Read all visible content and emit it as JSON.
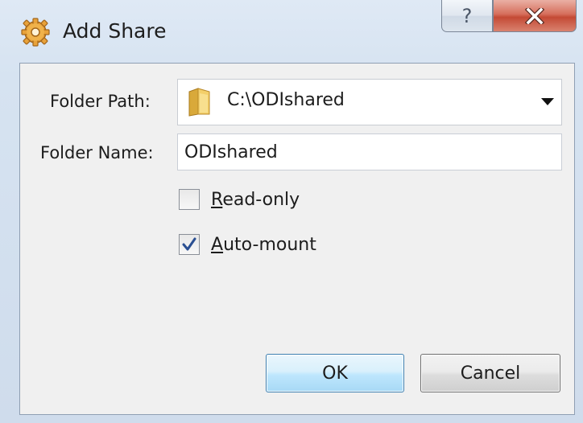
{
  "window": {
    "title": "Add Share",
    "help_glyph": "?",
    "close_glyph": "X",
    "icon": "gear-icon"
  },
  "form": {
    "folder_path": {
      "label": "Folder Path:",
      "value": "C:\\ODIshared",
      "icon": "folder-icon"
    },
    "folder_name": {
      "label": "Folder Name:",
      "value": "ODIshared"
    },
    "read_only": {
      "label_mnemonic": "R",
      "label_rest": "ead-only",
      "checked": false
    },
    "auto_mount": {
      "label_mnemonic": "A",
      "label_rest": "uto-mount",
      "checked": true
    }
  },
  "buttons": {
    "ok_label": "OK",
    "cancel_label": "Cancel"
  },
  "colors": {
    "close_red": "#c44a35",
    "ok_border": "#3c7fb1",
    "check_blue": "#2a4f92"
  }
}
